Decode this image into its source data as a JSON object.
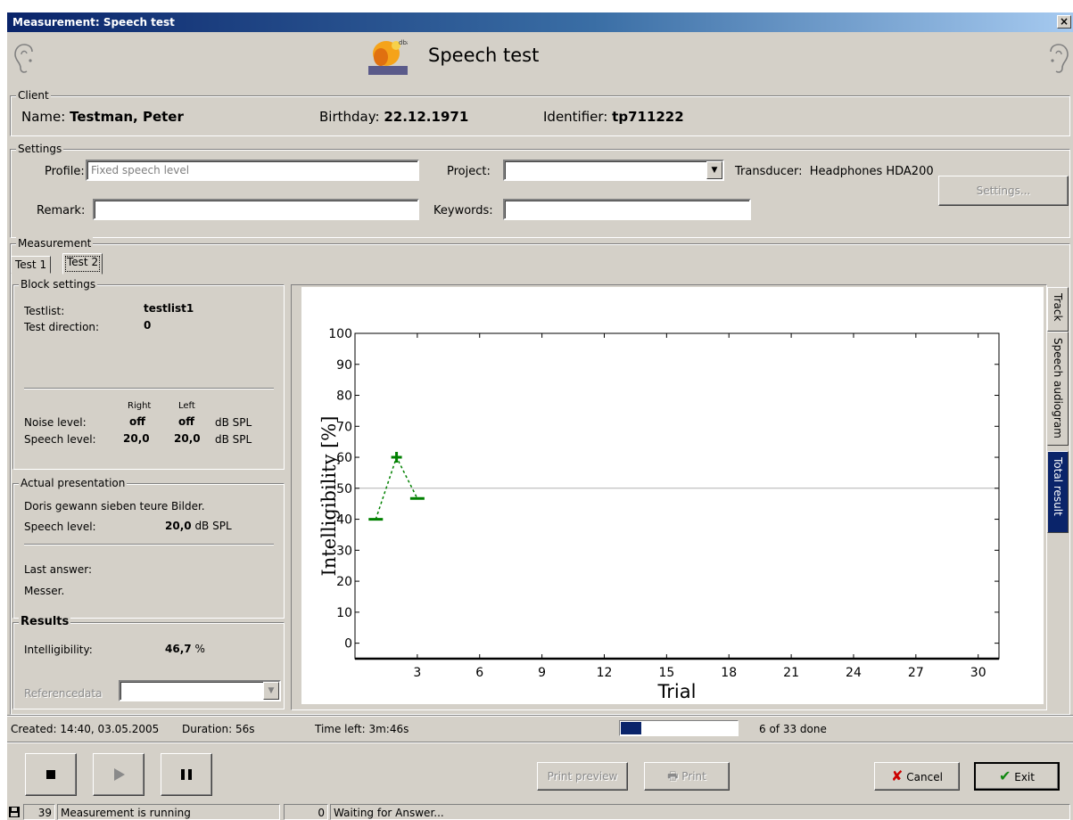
{
  "window": {
    "title": "Measurement: Speech test",
    "close": "×"
  },
  "header": {
    "title": "Speech test"
  },
  "client": {
    "legend": "Client",
    "name_label": "Name:",
    "name": "Testman, Peter",
    "birthday_label": "Birthday:",
    "birthday": "22.12.1971",
    "identifier_label": "Identifier:",
    "identifier": "tp711222"
  },
  "settings": {
    "legend": "Settings",
    "profile_label": "Profile:",
    "profile_value": "Fixed speech level",
    "project_label": "Project:",
    "project_value": "",
    "remark_label": "Remark:",
    "remark_value": "",
    "keywords_label": "Keywords:",
    "keywords_value": "",
    "transducer_label": "Transducer:",
    "transducer": "Headphones HDA200",
    "settings_button": "Settings..."
  },
  "measurement": {
    "legend": "Measurement",
    "tabs": [
      {
        "label": "Test 1"
      },
      {
        "label": "Test 2"
      }
    ]
  },
  "block": {
    "legend": "Block settings",
    "testlist_label": "Testlist:",
    "testlist": "testlist1",
    "direction_label": "Test direction:",
    "direction": "0",
    "right_label": "Right",
    "left_label": "Left",
    "noise_label": "Noise level:",
    "noise_right": "off",
    "noise_left": "off",
    "noise_unit": "dB SPL",
    "speech_label": "Speech level:",
    "speech_right": "20,0",
    "speech_left": "20,0",
    "speech_unit": "dB SPL"
  },
  "actual": {
    "legend": "Actual presentation",
    "sentence": "Doris gewann sieben teure Bilder.",
    "speech_label": "Speech level:",
    "speech_value": "20,0",
    "speech_unit": "dB SPL",
    "last_answer_label": "Last answer:",
    "last_answer": "Messer."
  },
  "results": {
    "legend": "Results",
    "intell_label": "Intelligibility:",
    "intell_value": "46,7",
    "intell_unit": "%",
    "ref_label": "Referencedata",
    "ref_value": ""
  },
  "side_tabs": [
    {
      "label": "Track"
    },
    {
      "label": "Speech audiogram"
    },
    {
      "label": "Total result"
    }
  ],
  "chart_data": {
    "type": "line",
    "xlabel": "Trial",
    "ylabel": "Intelligibility [%]",
    "xlim": [
      0,
      31
    ],
    "ylim": [
      -5,
      100
    ],
    "x_ticks": [
      3,
      6,
      9,
      12,
      15,
      18,
      21,
      24,
      27,
      30
    ],
    "y_ticks": [
      0,
      10,
      20,
      30,
      40,
      50,
      60,
      70,
      80,
      90,
      100
    ],
    "reference_line": 50,
    "series_color": "#008000",
    "points": [
      {
        "x": 1,
        "y": 40,
        "marker": "−"
      },
      {
        "x": 2,
        "y": 60,
        "marker": "+"
      },
      {
        "x": 3,
        "y": 46.7,
        "marker": "−"
      }
    ]
  },
  "info": {
    "created": "Created: 14:40, 03.05.2005",
    "duration": "Duration: 56s",
    "time_left": "Time left: 3m:46s",
    "progress_pct": 18,
    "progress_label": "18 %",
    "done": "6 of 33 done"
  },
  "buttons": {
    "print_preview": "Print preview",
    "print": "Print",
    "cancel": "Cancel",
    "exit": "Exit"
  },
  "status": {
    "count": "39",
    "message": "Measurement is running",
    "count2": "0",
    "message2": "Waiting for Answer..."
  }
}
